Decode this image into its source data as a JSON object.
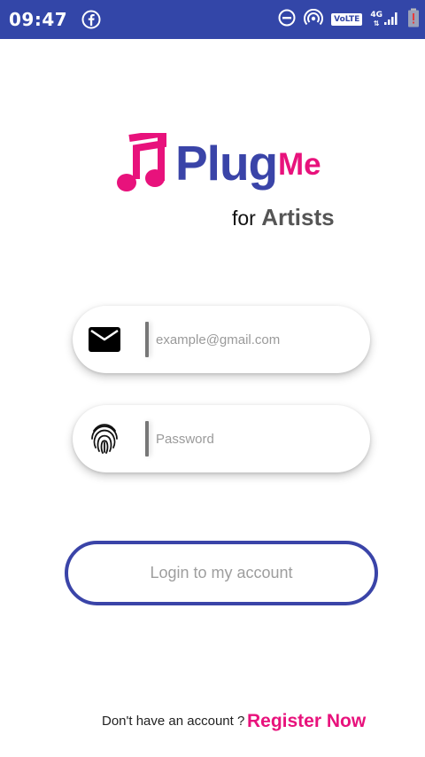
{
  "status_bar": {
    "time": "09:47",
    "network_label": "VoLTE",
    "network_type": "4G",
    "icons": [
      "facebook-icon",
      "do-not-disturb-icon",
      "hotspot-icon",
      "volte-icon",
      "signal-icon",
      "battery-icon"
    ]
  },
  "brand": {
    "name": "Plug",
    "name_suffix": "Me",
    "tagline_prefix": "for",
    "tagline_bold": "Artists",
    "colors": {
      "primary": "#3a44a8",
      "accent": "#e8127c"
    }
  },
  "login_form": {
    "email": {
      "placeholder": "example@gmail.com",
      "value": "",
      "icon": "mail-icon"
    },
    "password": {
      "placeholder": "Password",
      "value": "",
      "icon": "fingerprint-icon"
    },
    "submit_label": "Login to my account"
  },
  "footer": {
    "prompt": "Don't have an account ?",
    "register_label": "Register Now"
  }
}
